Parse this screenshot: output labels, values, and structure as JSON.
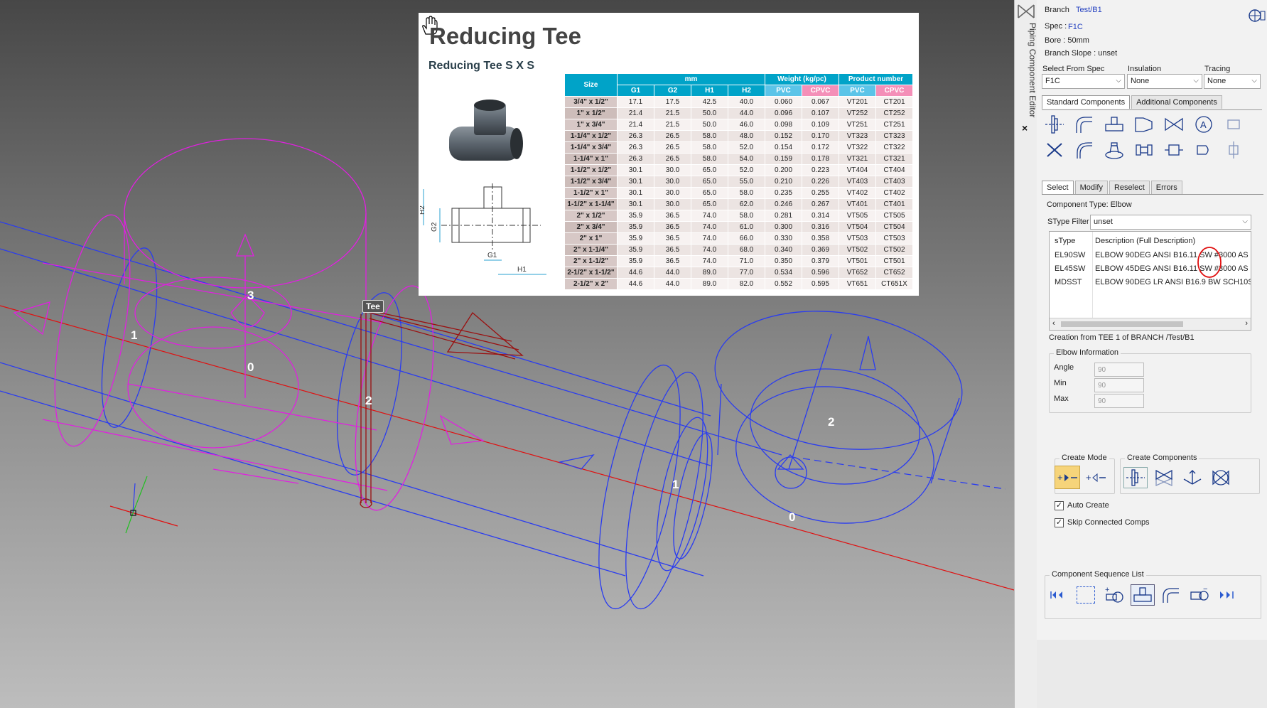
{
  "viewport": {
    "labels": [
      {
        "id": "m1",
        "text": "1"
      },
      {
        "id": "m3",
        "text": "3"
      },
      {
        "id": "m0",
        "text": "0"
      },
      {
        "id": "m2",
        "text": "2"
      },
      {
        "id": "b1",
        "text": "1"
      },
      {
        "id": "b2",
        "text": "2"
      },
      {
        "id": "b0",
        "text": "0"
      }
    ],
    "tee_tag": "Tee",
    "colors": {
      "magenta": "#e020e0",
      "blue": "#2a3cf0",
      "red": "#e01010",
      "darkred": "#9a1010",
      "green": "#20c020"
    }
  },
  "catalog": {
    "title": "Reducing Tee",
    "subtitle": "Reducing Tee S X S",
    "drawing_labels": {
      "h2": "H2",
      "g2": "G2",
      "g1": "G1",
      "h1": "H1"
    },
    "header_top": {
      "size": "Size",
      "mm": "mm",
      "weight": "Weight (kg/pc)",
      "product": "Product number"
    },
    "header_sub": [
      "G1",
      "G2",
      "H1",
      "H2",
      "PVC",
      "CPVC",
      "PVC",
      "CPVC"
    ],
    "rows": [
      [
        "3/4\" x 1/2\"",
        "17.1",
        "17.5",
        "42.5",
        "40.0",
        "0.060",
        "0.067",
        "VT201",
        "CT201"
      ],
      [
        "1\" x 1/2\"",
        "21.4",
        "21.5",
        "50.0",
        "44.0",
        "0.096",
        "0.107",
        "VT252",
        "CT252"
      ],
      [
        "1\" x 3/4\"",
        "21.4",
        "21.5",
        "50.0",
        "46.0",
        "0.098",
        "0.109",
        "VT251",
        "CT251"
      ],
      [
        "1-1/4\" x 1/2\"",
        "26.3",
        "26.5",
        "58.0",
        "48.0",
        "0.152",
        "0.170",
        "VT323",
        "CT323"
      ],
      [
        "1-1/4\" x 3/4\"",
        "26.3",
        "26.5",
        "58.0",
        "52.0",
        "0.154",
        "0.172",
        "VT322",
        "CT322"
      ],
      [
        "1-1/4\" x 1\"",
        "26.3",
        "26.5",
        "58.0",
        "54.0",
        "0.159",
        "0.178",
        "VT321",
        "CT321"
      ],
      [
        "1-1/2\" x 1/2\"",
        "30.1",
        "30.0",
        "65.0",
        "52.0",
        "0.200",
        "0.223",
        "VT404",
        "CT404"
      ],
      [
        "1-1/2\" x 3/4\"",
        "30.1",
        "30.0",
        "65.0",
        "55.0",
        "0.210",
        "0.226",
        "VT403",
        "CT403"
      ],
      [
        "1-1/2\" x 1\"",
        "30.1",
        "30.0",
        "65.0",
        "58.0",
        "0.235",
        "0.255",
        "VT402",
        "CT402"
      ],
      [
        "1-1/2\" x 1-1/4\"",
        "30.1",
        "30.0",
        "65.0",
        "62.0",
        "0.246",
        "0.267",
        "VT401",
        "CT401"
      ],
      [
        "2\" x 1/2\"",
        "35.9",
        "36.5",
        "74.0",
        "58.0",
        "0.281",
        "0.314",
        "VT505",
        "CT505"
      ],
      [
        "2\" x 3/4\"",
        "35.9",
        "36.5",
        "74.0",
        "61.0",
        "0.300",
        "0.316",
        "VT504",
        "CT504"
      ],
      [
        "2\" x 1\"",
        "35.9",
        "36.5",
        "74.0",
        "66.0",
        "0.330",
        "0.358",
        "VT503",
        "CT503"
      ],
      [
        "2\" x 1-1/4\"",
        "35.9",
        "36.5",
        "74.0",
        "68.0",
        "0.340",
        "0.369",
        "VT502",
        "CT502"
      ],
      [
        "2\" x 1-1/2\"",
        "35.9",
        "36.5",
        "74.0",
        "71.0",
        "0.350",
        "0.379",
        "VT501",
        "CT501"
      ],
      [
        "2-1/2\" x 1-1/2\"",
        "44.6",
        "44.0",
        "89.0",
        "77.0",
        "0.534",
        "0.596",
        "VT652",
        "CT652"
      ],
      [
        "2-1/2\" x 2\"",
        "44.6",
        "44.0",
        "89.0",
        "82.0",
        "0.552",
        "0.595",
        "VT651",
        "CT651X"
      ]
    ]
  },
  "side_strip": {
    "title": "Piping Component Editor",
    "close": "×"
  },
  "panel": {
    "branch_label": "Branch",
    "branch_value": "Test/B1",
    "spec_label": "Spec :",
    "spec_value": "F1C",
    "bore": "Bore :   50mm",
    "branch_slope": "Branch Slope :  unset",
    "select_from_spec_label": "Select From Spec",
    "select_from_spec_value": "F1C",
    "insulation_label": "Insulation",
    "insulation_value": "None",
    "tracing_label": "Tracing",
    "tracing_value": "None",
    "comp_tabs": [
      "Standard Components",
      "Additional Components"
    ],
    "mode_tabs": [
      "Select",
      "Modify",
      "Reselect",
      "Errors"
    ],
    "component_type": "Component Type: Elbow",
    "stype_filter_label": "SType Filter",
    "stype_filter_value": "unset",
    "list_headers": [
      "sType",
      "Description (Full Description)"
    ],
    "list_rows": [
      [
        "EL90SW",
        "ELBOW 90DEG ANSI B16.11 SW #3000  AS"
      ],
      [
        "EL45SW",
        "ELBOW 45DEG ANSI B16.11 SW #3000  AS"
      ],
      [
        "MDSST",
        "ELBOW 90DEG LR ANSI B16.9 BW SCH10S"
      ]
    ],
    "creation_from": "Creation from TEE 1 of BRANCH /Test/B1",
    "elbow_info_title": "Elbow Information",
    "angle_label": "Angle",
    "angle_value": "90",
    "min_label": "Min",
    "min_value": "90",
    "max_label": "Max",
    "max_value": "90",
    "create_mode_label": "Create Mode",
    "create_components_label": "Create Components",
    "auto_create_label": "Auto Create",
    "skip_connected_label": "Skip Connected Comps",
    "sequence_title": "Component Sequence List",
    "highlight_color": "#e01010"
  }
}
